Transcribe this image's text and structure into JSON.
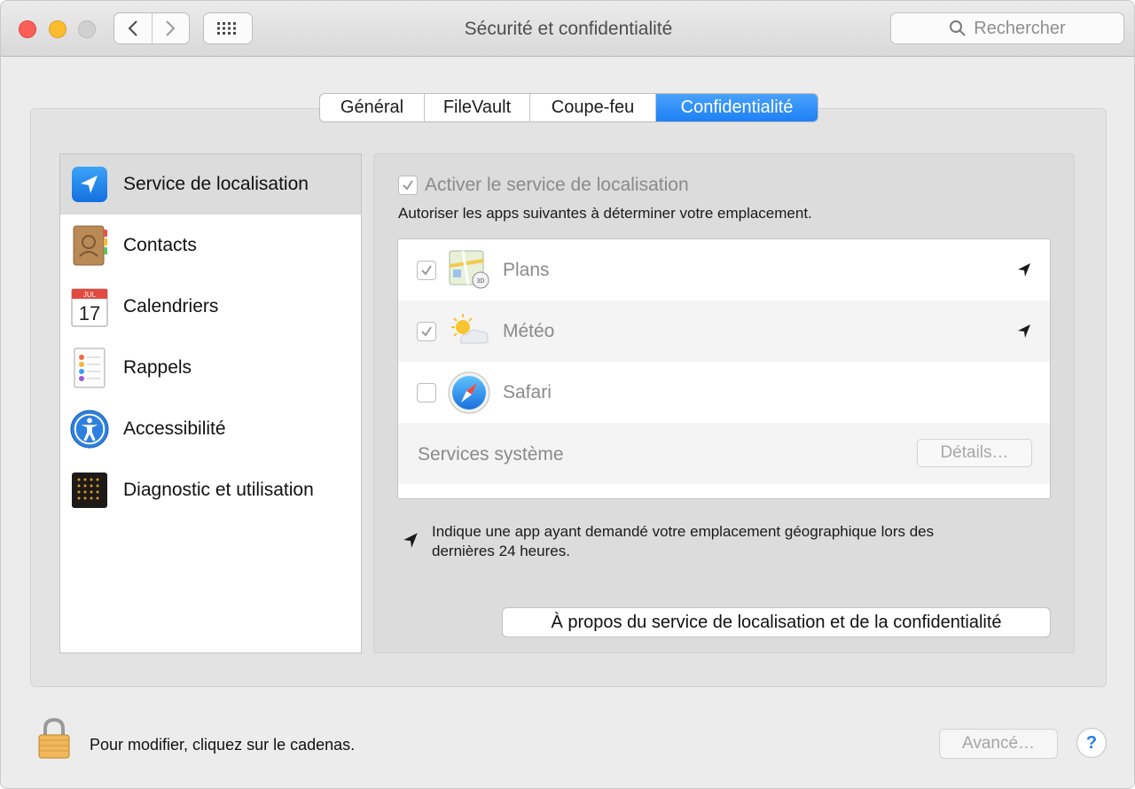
{
  "window": {
    "title": "Sécurité et confidentialité"
  },
  "search": {
    "placeholder": "Rechercher"
  },
  "tabs": [
    {
      "label": "Général"
    },
    {
      "label": "FileVault"
    },
    {
      "label": "Coupe-feu"
    },
    {
      "label": "Confidentialité",
      "active": true
    }
  ],
  "sidebar": {
    "items": [
      {
        "label": "Service de localisation",
        "icon": "location-services-icon",
        "selected": true
      },
      {
        "label": "Contacts",
        "icon": "contacts-icon"
      },
      {
        "label": "Calendriers",
        "icon": "calendar-icon",
        "calendar_month": "JUL",
        "calendar_day": "17"
      },
      {
        "label": "Rappels",
        "icon": "reminders-icon"
      },
      {
        "label": "Accessibilité",
        "icon": "accessibility-icon"
      },
      {
        "label": "Diagnostic et utilisation",
        "icon": "diagnostics-icon"
      }
    ]
  },
  "location": {
    "enable_label": "Activer le service de localisation",
    "enable_checked": true,
    "allow_text": "Autoriser les apps suivantes à déterminer votre emplacement.",
    "apps": [
      {
        "name": "Plans",
        "icon": "maps-icon",
        "checked": true,
        "recent_request": true
      },
      {
        "name": "Météo",
        "icon": "weather-icon",
        "checked": true,
        "recent_request": true
      },
      {
        "name": "Safari",
        "icon": "safari-icon",
        "checked": false,
        "recent_request": false
      }
    ],
    "services_label": "Services système",
    "details_label": "Détails…",
    "legend_text_line1": "Indique une app ayant demandé votre emplacement géographique lors des",
    "legend_text_line2": "dernières 24 heures.",
    "about_label": "À propos du service de localisation et de la confidentialité"
  },
  "footer": {
    "lock_text": "Pour modifier, cliquez sur le cadenas.",
    "advanced_label": "Avancé…",
    "help_label": "?"
  },
  "colors": {
    "accent": "#1d80f5",
    "close": "#fc5f57",
    "minimize": "#fdbb2e"
  }
}
